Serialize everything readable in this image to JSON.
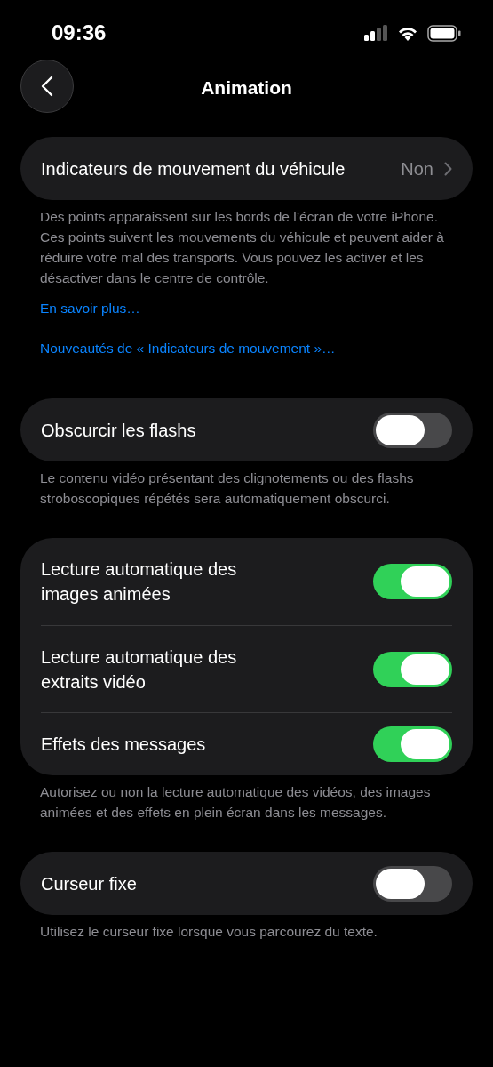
{
  "status_bar": {
    "time": "09:36"
  },
  "nav": {
    "title": "Animation"
  },
  "sections": [
    {
      "rows": [
        {
          "kind": "disclosure",
          "label": "Indicateurs de mouvement du véhicule",
          "value": "Non"
        }
      ],
      "footer": "Des points apparaissent sur les bords de l’écran de votre iPhone. Ces points suivent les mouvements du véhicule et peuvent aider à réduire votre mal des transports. Vous pouvez les activer et les désactiver dans le centre de contrôle.",
      "links": [
        "En savoir plus…",
        "Nouveautés de « Indicateurs de mouvement »…"
      ]
    },
    {
      "rows": [
        {
          "kind": "toggle",
          "label": "Obscurcir les flashs",
          "on": false
        }
      ],
      "footer": "Le contenu vidéo présentant des clignotements ou des flashs stroboscopiques répétés sera automatiquement obscurci."
    },
    {
      "rows": [
        {
          "kind": "toggle",
          "label": "Lecture automatique des images animées",
          "on": true
        },
        {
          "kind": "toggle",
          "label": "Lecture automatique des extraits vidéo",
          "on": true
        },
        {
          "kind": "toggle",
          "label": "Effets des messages",
          "on": true
        }
      ],
      "footer": "Autorisez ou non la lecture automatique des vidéos, des images animées et des effets en plein écran dans les messages."
    },
    {
      "rows": [
        {
          "kind": "toggle",
          "label": "Curseur fixe",
          "on": false
        }
      ],
      "footer": "Utilisez le curseur fixe lorsque vous parcourez du texte."
    }
  ]
}
